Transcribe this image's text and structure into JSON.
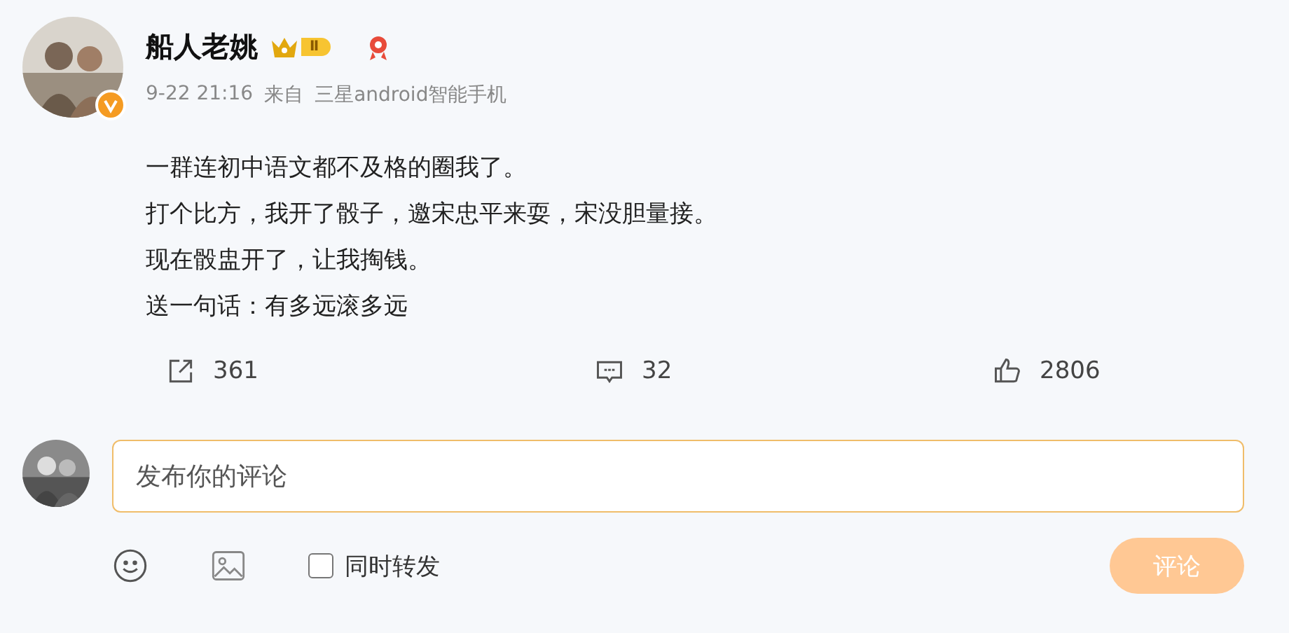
{
  "post": {
    "author": "船人老姚",
    "level_badge": "Ⅱ",
    "timestamp": "9-22 21:16",
    "source_label": "来自",
    "source": "三星android智能手机",
    "lines": [
      "一群连初中语文都不及格的圈我了。",
      "打个比方，我开了骰子，邀宋忠平来耍，宋没胆量接。",
      "现在骰盅开了，让我掏钱。",
      "送一句话：有多远滚多远"
    ],
    "actions": [
      {
        "kind": "repost",
        "count": "361"
      },
      {
        "kind": "comment",
        "count": "32"
      },
      {
        "kind": "like",
        "count": "2806"
      }
    ]
  },
  "composer": {
    "placeholder": "发布你的评论",
    "repost_option": {
      "label": "同时转发",
      "checked": false
    },
    "submit": {
      "label": "评论",
      "disabled": true
    }
  }
}
